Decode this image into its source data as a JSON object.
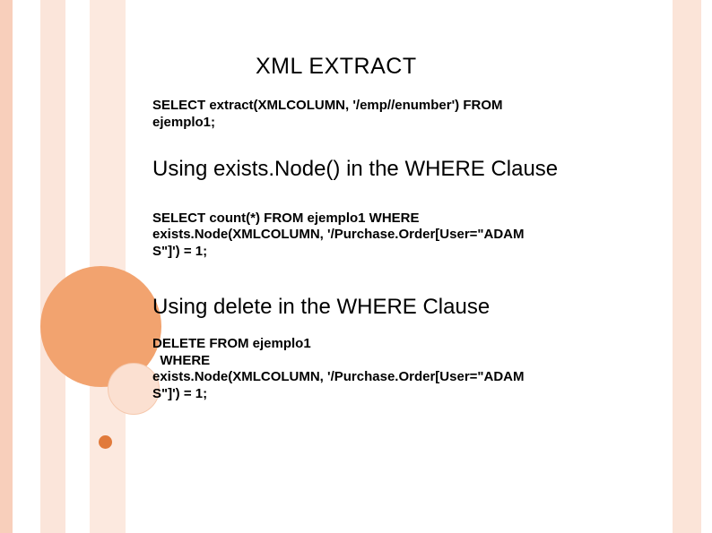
{
  "title": "XML EXTRACT",
  "block1": {
    "line1": "SELECT extract(XMLCOLUMN, '/emp//enumber') FROM",
    "line2": "ejemplo1;"
  },
  "subtitle1": "Using exists.Node() in the WHERE Clause",
  "block2": {
    "line1": "SELECT count(*) FROM ejemplo1 WHERE",
    "line2": "exists.Node(XMLCOLUMN, '/Purchase.Order[User=\"ADAM",
    "line3": "S\"]') = 1;"
  },
  "subtitle2": "Using delete in the WHERE Clause",
  "block3": {
    "line1": "DELETE FROM ejemplo1",
    "line2": "  WHERE",
    "line3": "exists.Node(XMLCOLUMN, '/Purchase.Order[User=\"ADAM",
    "line4": "S\"]') = 1;"
  }
}
